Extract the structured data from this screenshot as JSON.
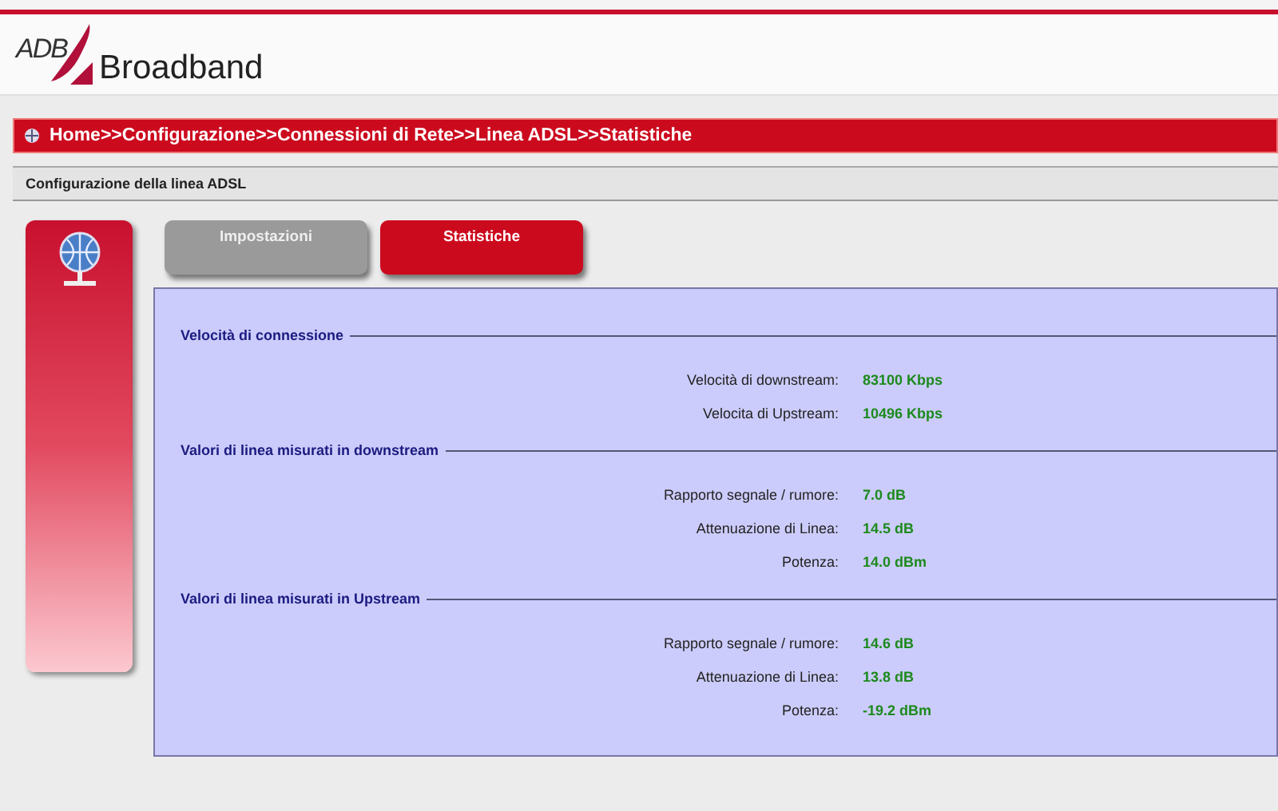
{
  "logo": {
    "mark": "ADB",
    "name": "Broadband"
  },
  "breadcrumb": "Home>>Configurazione>>Connessioni di Rete>>Linea ADSL>>Statistiche",
  "section_title": "Configurazione della linea ADSL",
  "tabs": [
    {
      "label": "Impostazioni",
      "selected": false
    },
    {
      "label": "Statistiche",
      "selected": true
    }
  ],
  "groups": [
    {
      "title": "Velocità di connessione",
      "rows": [
        {
          "label": "Velocità di downstream:",
          "value": "83100 Kbps"
        },
        {
          "label": "Velocita di Upstream:",
          "value": "10496 Kbps"
        }
      ]
    },
    {
      "title": "Valori di linea misurati in downstream",
      "rows": [
        {
          "label": "Rapporto segnale / rumore:",
          "value": "7.0 dB"
        },
        {
          "label": "Attenuazione di Linea:",
          "value": "14.5 dB"
        },
        {
          "label": "Potenza:",
          "value": "14.0 dBm"
        }
      ]
    },
    {
      "title": "Valori di linea misurati in Upstream",
      "rows": [
        {
          "label": "Rapporto segnale / rumore:",
          "value": "14.6 dB"
        },
        {
          "label": "Attenuazione di Linea:",
          "value": "13.8 dB"
        },
        {
          "label": "Potenza:",
          "value": "-19.2 dBm"
        }
      ]
    }
  ]
}
